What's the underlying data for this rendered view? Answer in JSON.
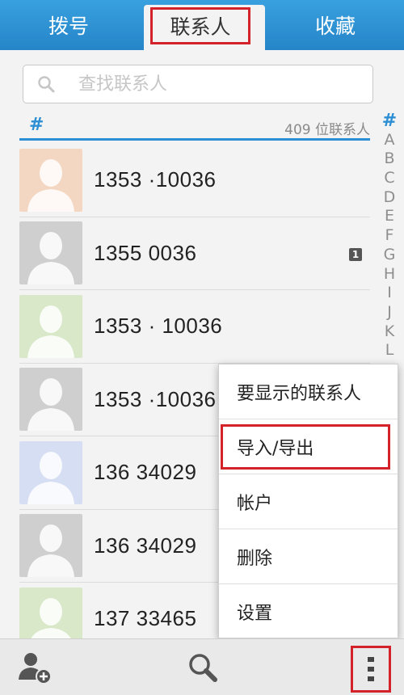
{
  "tabs": {
    "dial": "拨号",
    "contacts": "联系人",
    "favorites": "收藏"
  },
  "search": {
    "placeholder": "查找联系人"
  },
  "section": {
    "header": "#",
    "count": "409 位联系人"
  },
  "index_letters": [
    "#",
    "A",
    "B",
    "C",
    "D",
    "E",
    "F",
    "G",
    "H",
    "I",
    "J",
    "K",
    "L"
  ],
  "contacts": [
    {
      "number": "1353  ·10036",
      "avatar_color": "#f3d7c2",
      "badge": ""
    },
    {
      "number": "1355   0036",
      "avatar_color": "#cfcfcf",
      "badge": "1"
    },
    {
      "number": "1353 · 10036",
      "avatar_color": "#d9e8c8",
      "badge": ""
    },
    {
      "number": "1353  ·10036",
      "avatar_color": "#cfcfcf",
      "badge": ""
    },
    {
      "number": "136  34029",
      "avatar_color": "#d5def2",
      "badge": ""
    },
    {
      "number": "136  34029",
      "avatar_color": "#cfcfcf",
      "badge": ""
    },
    {
      "number": "137  33465",
      "avatar_color": "#d9e8c8",
      "badge": ""
    }
  ],
  "menu": {
    "items": [
      "要显示的联系人",
      "导入/导出",
      "帐户",
      "删除",
      "设置"
    ]
  },
  "colors": {
    "accent": "#2d8fd3",
    "highlight": "#d3222a"
  },
  "icons": {
    "add_contact": "add-contact-icon",
    "search": "search-icon",
    "more": "more-vertical-icon"
  }
}
